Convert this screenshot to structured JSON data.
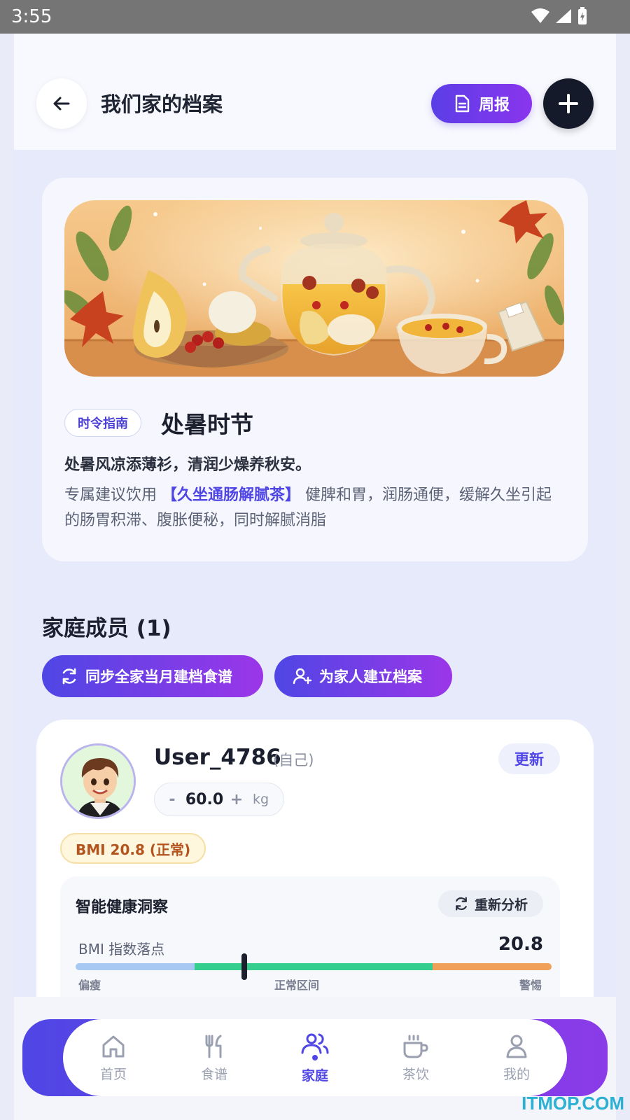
{
  "status_bar": {
    "time": "3:55"
  },
  "header": {
    "title": "我们家的档案",
    "weekly_label": "周报"
  },
  "season": {
    "tag": "时令指南",
    "title": "处暑时节",
    "poem": "处暑风凉添薄衫，清润少燥养秋安。",
    "advice_prefix": "专属建议饮用",
    "advice_highlight": "【久坐通肠解腻茶】",
    "advice_suffix": "健脾和胃，润肠通便，缓解久坐引起的肠胃积滞、腹胀便秘，同时解腻消脂"
  },
  "members": {
    "title": "家庭成员 (1)",
    "sync_label": "同步全家当月建档食谱",
    "create_label": "为家人建立档案"
  },
  "member": {
    "name": "User_4786",
    "relation": "(自己)",
    "update_label": "更新",
    "weight": "60.0",
    "weight_unit": "kg",
    "minus": "-",
    "plus": "+",
    "bmi_badge": "BMI 20.8 (正常)"
  },
  "insight": {
    "title": "智能健康洞察",
    "reanalyze_label": "重新分析",
    "bmi_label": "BMI 指数落点",
    "bmi_value": "20.8",
    "bmi_position": 0.355,
    "scale": {
      "low": "偏瘦",
      "normal": "正常区间",
      "high": "警惕"
    },
    "segments": [
      0.25,
      0.5,
      0.25
    ],
    "colors": {
      "low": "#a6c8f2",
      "normal": "#34cf8e",
      "high": "#f1a05a"
    }
  },
  "nav": {
    "items": [
      {
        "label": "首页",
        "icon": "home-icon"
      },
      {
        "label": "食谱",
        "icon": "utensils-icon"
      },
      {
        "label": "家庭",
        "icon": "family-icon"
      },
      {
        "label": "茶饮",
        "icon": "cup-icon"
      },
      {
        "label": "我的",
        "icon": "user-icon"
      }
    ],
    "active": "家庭"
  },
  "watermark": "ITMOP.COM",
  "colors": {
    "accent": "#4f46e5",
    "accent2": "#8b3be8",
    "dark": "#141a29"
  }
}
